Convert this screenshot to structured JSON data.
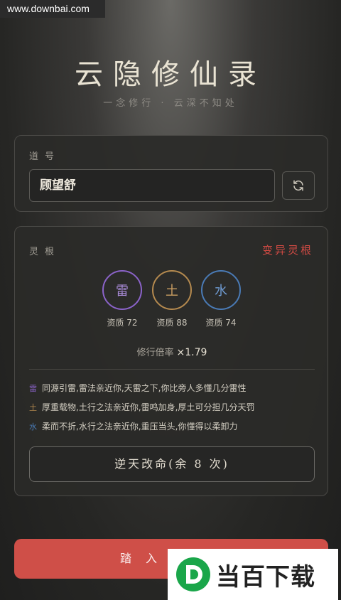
{
  "watermark": {
    "site": "www.downbai.com",
    "logo_text": "当百下载"
  },
  "header": {
    "title": "云隐修仙录",
    "subtitle": "一念修行 · 云深不知处"
  },
  "name_card": {
    "label": "道号",
    "value": "顾望舒"
  },
  "root_card": {
    "label": "灵根",
    "variant": "变异灵根",
    "roots": [
      {
        "glyph": "雷",
        "aptitude": "资质 72",
        "color": "#8b63c9"
      },
      {
        "glyph": "土",
        "aptitude": "资质 88",
        "color": "#b58a4f"
      },
      {
        "glyph": "水",
        "aptitude": "资质 74",
        "color": "#4a7bb6"
      }
    ],
    "rate_label": "修行倍率",
    "rate_value": "×1.79",
    "traits": [
      {
        "tag": "雷",
        "text": "同源引雷,雷法亲近你,天雷之下,你比旁人多懂几分雷性"
      },
      {
        "tag": "土",
        "text": "厚重载物,土行之法亲近你,雷鸣加身,厚土可分担几分天罚"
      },
      {
        "tag": "水",
        "text": "柔而不折,水行之法亲近你,重压当头,你懂得以柔卸力"
      }
    ],
    "reroll_label": "逆天改命(余 8 次)"
  },
  "enter_button": {
    "label": "踏入仙途"
  }
}
